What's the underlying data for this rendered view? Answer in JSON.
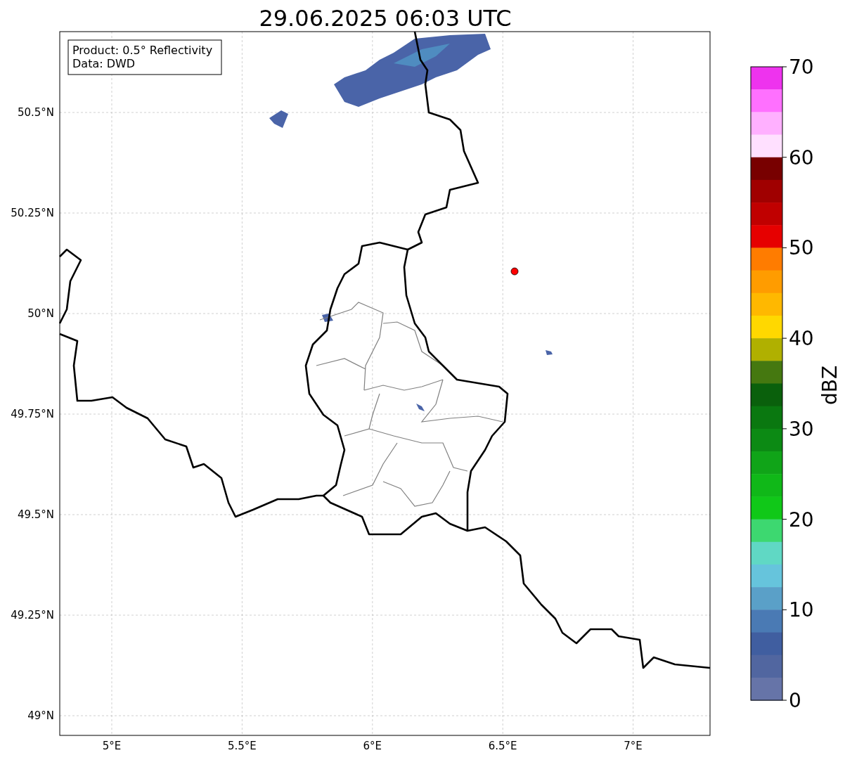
{
  "title": "29.06.2025 06:03 UTC",
  "legend": [
    "Product: 0.5° Reflectivity",
    "Data: DWD"
  ],
  "map": {
    "y_ticks": [
      "50.5°N",
      "50.25°N",
      "50°N",
      "49.75°N",
      "49.5°N",
      "49.25°N",
      "49°N"
    ],
    "x_ticks": [
      "5°E",
      "5.5°E",
      "6°E",
      "6.5°E",
      "7°E"
    ]
  },
  "colorbar": {
    "label": "dBZ",
    "ticks": [
      "70",
      "60",
      "50",
      "40",
      "30",
      "20",
      "10",
      "0"
    ],
    "bands": [
      {
        "color": "#ee33ee"
      },
      {
        "color": "#ff70ff"
      },
      {
        "color": "#ffb0ff"
      },
      {
        "color": "#ffe0ff"
      },
      {
        "color": "#780000"
      },
      {
        "color": "#a00000"
      },
      {
        "color": "#c00000"
      },
      {
        "color": "#e60000"
      },
      {
        "color": "#ff7c00"
      },
      {
        "color": "#ff9c00"
      },
      {
        "color": "#ffb800"
      },
      {
        "color": "#ffd800"
      },
      {
        "color": "#b0b000"
      },
      {
        "color": "#457810"
      },
      {
        "color": "#0a600c"
      },
      {
        "color": "#0a7810"
      },
      {
        "color": "#0c8a14"
      },
      {
        "color": "#10a418"
      },
      {
        "color": "#10b818"
      },
      {
        "color": "#10c818"
      },
      {
        "color": "#3dd870"
      },
      {
        "color": "#60d8c4"
      },
      {
        "color": "#66c4dc"
      },
      {
        "color": "#5aa0c8"
      },
      {
        "color": "#4a7ab4"
      },
      {
        "color": "#405ea0"
      },
      {
        "color": "#5166a0"
      },
      {
        "color": "#6674a8"
      }
    ]
  }
}
